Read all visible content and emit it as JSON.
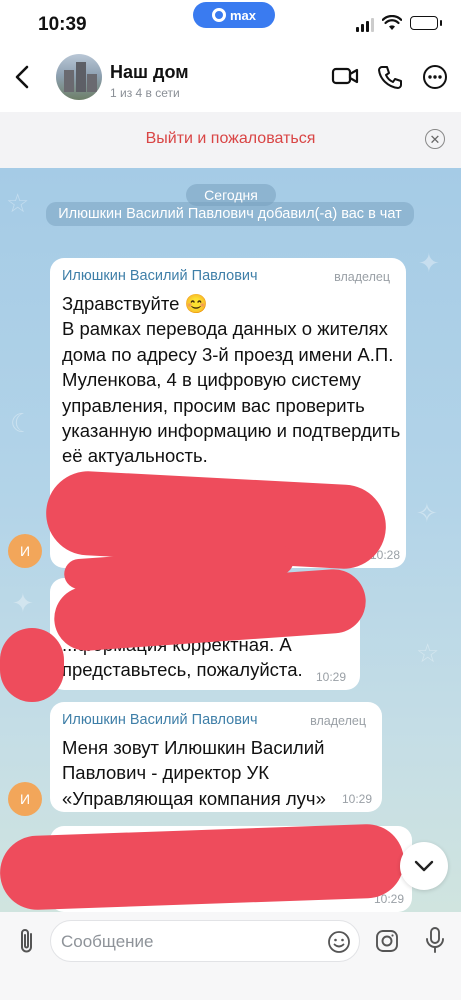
{
  "status_bar": {
    "time": "10:39",
    "pill_label": "max"
  },
  "header": {
    "title": "Наш дом",
    "subtitle": "1 из 4 в сети",
    "icons": [
      "back-arrow-icon",
      "video-call-icon",
      "phone-icon",
      "more-icon"
    ]
  },
  "banner": {
    "text": "Выйти и пожаловаться",
    "close_icon": "close-icon"
  },
  "chat": {
    "date_label": "Сегодня",
    "system_message": "Илюшкин Василий Павлович добавил(-а) вас в чат",
    "messages": [
      {
        "sender": "Илюшкин Василий Павлович",
        "role": "владелец",
        "text": "Здравствуйте 😊\nВ рамках перевода данных о жителях дома по адресу 3-й проезд имени А.П. Муленкова, 4 в цифровую систему управления, просим вас проверить указанную информацию и подтвердить её актуальность.",
        "time": "10:28",
        "avatar_letter": "И"
      },
      {
        "text": "...формация корректная. А\nпредставьтесь, пожалуйста.",
        "time": "10:29"
      },
      {
        "sender": "Илюшкин Василий Павлович",
        "role": "владелец",
        "text": "Меня зовут Илюшкин Василий Павлович - директор УК «Управляющая компания луч»",
        "time": "10:29",
        "avatar_letter": "И"
      },
      {
        "time": "10:29"
      }
    ]
  },
  "input": {
    "placeholder": "Сообщение",
    "icons": [
      "attach-icon",
      "sticker-icon",
      "camera-icon",
      "microphone-icon"
    ]
  },
  "colors": {
    "accent": "#3a7bf0",
    "banner_text": "#d94545",
    "sender_name": "#3f7fa8",
    "redaction": "#ee4c5c",
    "avatar": "#f2a65a"
  }
}
